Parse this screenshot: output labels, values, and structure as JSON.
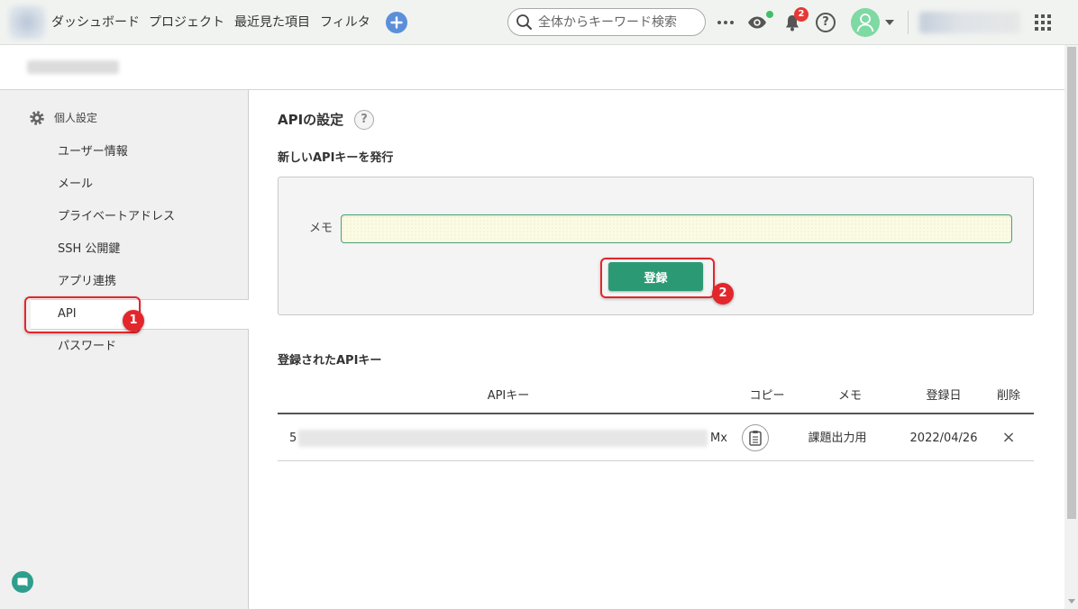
{
  "colors": {
    "accent": "#2b9a74",
    "annotation": "#e3262b",
    "add_button": "#5b8fd9",
    "avatar": "#7ed9a3",
    "badge": "#e53935",
    "online_dot": "#3fbf6a",
    "chat": "#2f9e8c"
  },
  "icons": {
    "logo": "space-logo",
    "add": "plus-icon",
    "search": "search-icon",
    "more": "more-icon",
    "watch": "eye-icon",
    "notifications": "bell-icon",
    "help": "help-icon",
    "help_glyph": "?",
    "user": "user-icon",
    "menu": "caret-down-icon",
    "apps": "grid-icon",
    "settings": "gear-icon",
    "copy": "clipboard-icon",
    "delete": "close-icon",
    "delete_glyph": "×",
    "chat": "chat-icon"
  },
  "header": {
    "nav": [
      "ダッシュボード",
      "プロジェクト",
      "最近見た項目",
      "フィルタ"
    ],
    "search": {
      "placeholder": "全体からキーワード検索"
    },
    "notification_count": "2"
  },
  "sidebar": {
    "section_title": "個人設定",
    "items": [
      {
        "label": "ユーザー情報",
        "selected": false
      },
      {
        "label": "メール",
        "selected": false
      },
      {
        "label": "プライベートアドレス",
        "selected": false
      },
      {
        "label": "SSH 公開鍵",
        "selected": false
      },
      {
        "label": "アプリ連携",
        "selected": false
      },
      {
        "label": "API",
        "selected": true
      },
      {
        "label": "パスワード",
        "selected": false
      }
    ]
  },
  "main": {
    "title": "APIの設定",
    "new_key": {
      "heading": "新しいAPIキーを発行",
      "memo_label": "メモ",
      "memo_value": "",
      "submit_label": "登録"
    },
    "keys": {
      "heading": "登録されたAPIキー",
      "columns": {
        "key": "APIキー",
        "copy": "コピー",
        "memo": "メモ",
        "date": "登録日",
        "delete": "削除"
      },
      "rows": [
        {
          "key_start": "5",
          "key_end": "Mx",
          "memo": "課題出力用",
          "date": "2022/04/26"
        }
      ]
    }
  },
  "annotations": [
    {
      "label": "1"
    },
    {
      "label": "2"
    }
  ]
}
